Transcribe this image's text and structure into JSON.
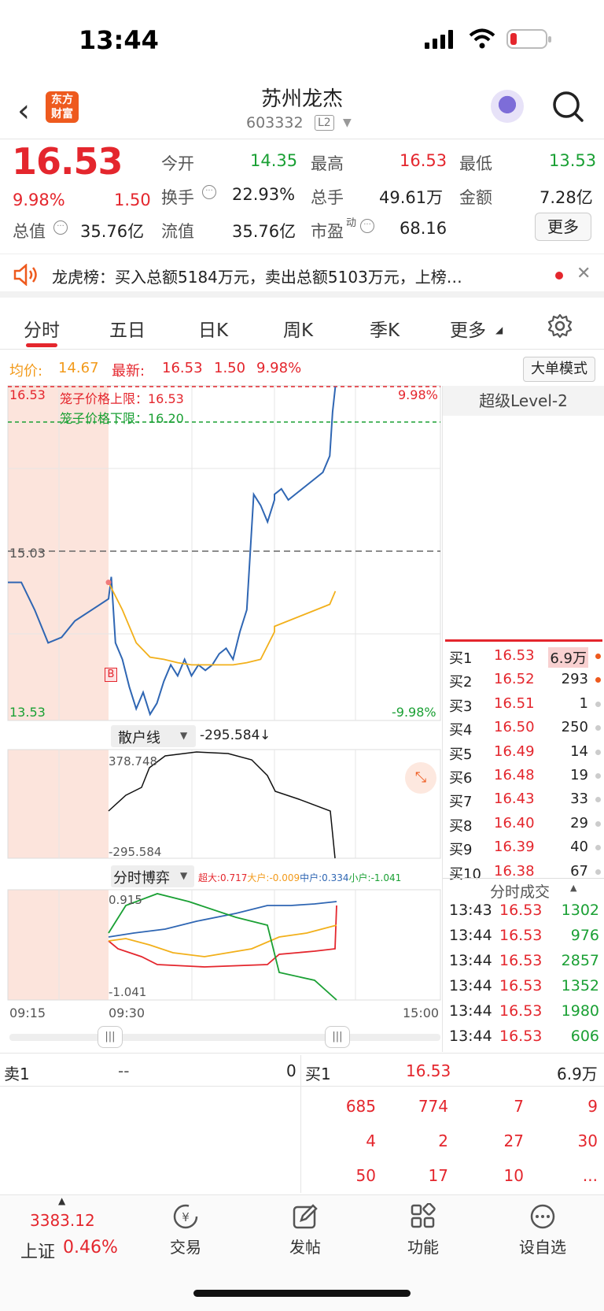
{
  "status": {
    "time": "13:44"
  },
  "header": {
    "logo_text": "东方\n财富",
    "name": "苏州龙杰",
    "code": "603332",
    "level_badge": "L2"
  },
  "quote": {
    "price": "16.53",
    "pct": "9.98%",
    "chg": "1.50",
    "open_label": "今开",
    "open": "14.35",
    "high_label": "最高",
    "high": "16.53",
    "low_label": "最低",
    "low": "13.53",
    "turnover_label": "换手",
    "turnover": "22.93%",
    "volume_label": "总手",
    "volume": "49.61万",
    "amount_label": "金额",
    "amount": "7.28亿",
    "mktcap_label": "总值",
    "mktcap": "35.76亿",
    "float_label": "流值",
    "float": "35.76亿",
    "pe_label": "市盈",
    "pe_sup": "动",
    "pe": "68.16",
    "more": "更多"
  },
  "notice": {
    "text": "龙虎榜：买入总额5184万元，卖出总额5103万元，上榜…"
  },
  "tabs": [
    "分时",
    "五日",
    "日K",
    "周K",
    "季K",
    "更多"
  ],
  "avgbar": {
    "avg_label": "均价:",
    "avg": "14.67",
    "latest_label": "最新:",
    "latest": "16.53",
    "chg": "1.50",
    "pct": "9.98%",
    "bigorder": "大单模式"
  },
  "chart_data": {
    "type": "line",
    "title": "",
    "price_axis": {
      "top": "16.53",
      "mid": "15.03",
      "bottom": "13.53",
      "top_pct": "9.98%",
      "bottom_pct": "-9.98%"
    },
    "cage_upper": "笼子价格上限：16.53",
    "cage_lower": "笼子价格下限：16.20",
    "time_ticks": [
      "09:15",
      "09:30",
      "15:00"
    ],
    "ylim": [
      13.53,
      16.53
    ],
    "series": [
      {
        "name": "price",
        "color": "#2f66b3",
        "x": [
          "09:15",
          "09:17",
          "09:19",
          "09:21",
          "09:23",
          "09:25",
          "09:30",
          "09:32",
          "09:35",
          "09:40",
          "09:45",
          "09:50",
          "09:55",
          "10:00",
          "10:05",
          "10:10",
          "10:15",
          "10:20",
          "10:25",
          "10:30",
          "10:35",
          "10:40",
          "10:45",
          "10:50",
          "10:55",
          "11:00",
          "11:05",
          "11:10",
          "11:15",
          "11:20",
          "11:25",
          "11:30",
          "13:00",
          "13:05",
          "13:10",
          "13:15",
          "13:20",
          "13:25",
          "13:30",
          "13:35",
          "13:40",
          "13:42",
          "13:44"
        ],
        "values": [
          14.75,
          14.75,
          14.5,
          14.2,
          14.25,
          14.4,
          14.6,
          14.8,
          14.2,
          14.05,
          13.8,
          13.6,
          13.75,
          13.55,
          13.65,
          13.85,
          14.0,
          13.9,
          14.05,
          13.9,
          14.0,
          13.95,
          14.0,
          14.1,
          14.15,
          14.05,
          14.3,
          14.5,
          15.55,
          15.45,
          15.3,
          15.5,
          15.55,
          15.6,
          15.5,
          15.55,
          15.6,
          15.65,
          15.7,
          15.75,
          15.9,
          16.3,
          16.53
        ]
      },
      {
        "name": "avg",
        "color": "#f2b01b",
        "x": [
          "09:30",
          "09:40",
          "09:50",
          "10:00",
          "10:10",
          "10:20",
          "10:30",
          "10:40",
          "10:50",
          "11:00",
          "11:10",
          "11:20",
          "11:30",
          "13:00",
          "13:10",
          "13:20",
          "13:30",
          "13:40",
          "13:44"
        ],
        "values": [
          14.75,
          14.5,
          14.2,
          14.07,
          14.05,
          14.02,
          14.0,
          14.0,
          14.0,
          14.0,
          14.02,
          14.05,
          14.3,
          14.35,
          14.4,
          14.45,
          14.5,
          14.55,
          14.67
        ]
      }
    ],
    "retail": {
      "label": "散户线",
      "value": "-295.584",
      "arrow": "↓",
      "max": "378.748",
      "min": "-295.584"
    },
    "game": {
      "label": "分时博弈",
      "super": "超大:0.717",
      "large": "大户:-0.009",
      "mid": "中户:0.334",
      "small": "小户:-1.041",
      "max": "0.915",
      "min": "-1.041"
    }
  },
  "level2": {
    "title": "超级Level-2"
  },
  "orderbook": [
    {
      "label": "买1",
      "price": "16.53",
      "vol": "6.9万"
    },
    {
      "label": "买2",
      "price": "16.52",
      "vol": "293"
    },
    {
      "label": "买3",
      "price": "16.51",
      "vol": "1"
    },
    {
      "label": "买4",
      "price": "16.50",
      "vol": "250"
    },
    {
      "label": "买5",
      "price": "16.49",
      "vol": "14"
    },
    {
      "label": "买6",
      "price": "16.48",
      "vol": "19"
    },
    {
      "label": "买7",
      "price": "16.43",
      "vol": "33"
    },
    {
      "label": "买8",
      "price": "16.40",
      "vol": "29"
    },
    {
      "label": "买9",
      "price": "16.39",
      "vol": "40"
    },
    {
      "label": "买10",
      "price": "16.38",
      "vol": "67"
    }
  ],
  "trades_title": "分时成交",
  "trades": [
    {
      "time": "13:43",
      "price": "16.53",
      "vol": "1302"
    },
    {
      "time": "13:44",
      "price": "16.53",
      "vol": "976"
    },
    {
      "time": "13:44",
      "price": "16.53",
      "vol": "2857"
    },
    {
      "time": "13:44",
      "price": "16.53",
      "vol": "1352"
    },
    {
      "time": "13:44",
      "price": "16.53",
      "vol": "1980"
    },
    {
      "time": "13:44",
      "price": "16.53",
      "vol": "606"
    }
  ],
  "bottom": {
    "sell1_label": "卖1",
    "sell1_price": "--",
    "sell1_vol": "0",
    "buy1_label": "买1",
    "buy1_price": "16.53",
    "buy1_vol": "6.9万",
    "queue": [
      [
        "685",
        "774",
        "7",
        "9"
      ],
      [
        "4",
        "2",
        "27",
        "30"
      ],
      [
        "50",
        "17",
        "10",
        "..."
      ]
    ]
  },
  "bottomnav": {
    "index_value": "3383.12",
    "index_name": "上证",
    "index_pct": "0.46%",
    "trade": "交易",
    "post": "发帖",
    "func": "功能",
    "watch": "设自选"
  }
}
